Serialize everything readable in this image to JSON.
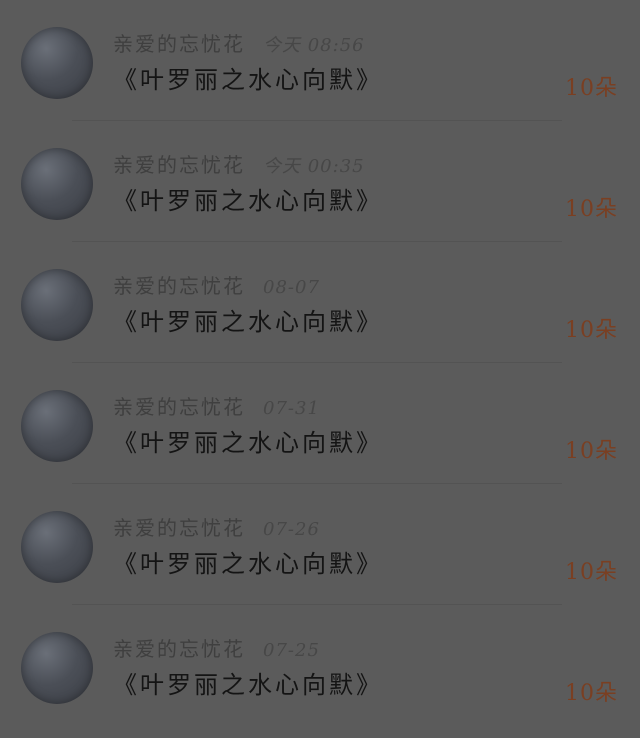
{
  "messages": [
    {
      "sender": "亲爱的忘忧花",
      "date": "今天 08:56",
      "title": "《叶罗丽之水心向默》",
      "count": "10朵"
    },
    {
      "sender": "亲爱的忘忧花",
      "date": "今天 00:35",
      "title": "《叶罗丽之水心向默》",
      "count": "10朵"
    },
    {
      "sender": "亲爱的忘忧花",
      "date": "08-07",
      "title": "《叶罗丽之水心向默》",
      "count": "10朵"
    },
    {
      "sender": "亲爱的忘忧花",
      "date": "07-31",
      "title": "《叶罗丽之水心向默》",
      "count": "10朵"
    },
    {
      "sender": "亲爱的忘忧花",
      "date": "07-26",
      "title": "《叶罗丽之水心向默》",
      "count": "10朵"
    },
    {
      "sender": "亲爱的忘忧花",
      "date": "07-25",
      "title": "《叶罗丽之水心向默》",
      "count": "10朵"
    }
  ],
  "icons": {
    "avatar": "user-avatar"
  },
  "colors": {
    "background": "#5b5b5b",
    "count_accent": "#7a3f22",
    "title_text": "#141414"
  }
}
